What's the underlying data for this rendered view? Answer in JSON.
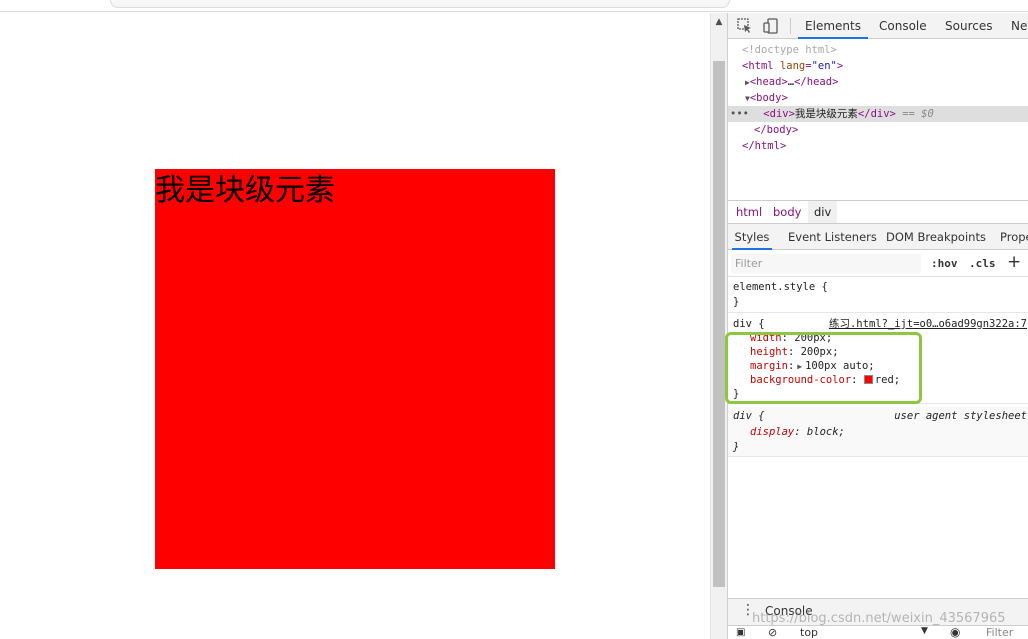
{
  "page": {
    "block_text": "我是块级元素",
    "box_color": "#ff0000"
  },
  "devtools": {
    "tabs": [
      "Elements",
      "Console",
      "Sources",
      "Net"
    ],
    "active_tab": "Elements",
    "icons": [
      "inspect-icon",
      "device-toolbar-icon"
    ],
    "tree": {
      "doctype": "<!doctype html>",
      "html_open_tag": "html",
      "html_attr": "lang",
      "html_attr_val": "\"en\"",
      "head": "head",
      "head_ellipsis": "…",
      "body": "body",
      "div": "div",
      "div_text": "我是块级元素",
      "eq": "== $0",
      "dots": "•••",
      "body_close": "body",
      "html_close": "html"
    },
    "breadcrumbs": [
      "html",
      "body",
      "div"
    ],
    "style_tabs": [
      "Styles",
      "Event Listeners",
      "DOM Breakpoints",
      "Prope"
    ],
    "filter_placeholder": "Filter",
    "hov": ":hov",
    "cls": ".cls",
    "plus": "+",
    "element_style": {
      "selector": "element.style {",
      "close": "}"
    },
    "div_rule": {
      "selector": "div {",
      "source": "练习.html?_ijt=o0…o6ad99gn322a:7",
      "props": [
        {
          "name": "width",
          "value": "200px;"
        },
        {
          "name": "height",
          "value": "200px;"
        },
        {
          "name": "margin",
          "value": "100px auto;"
        },
        {
          "name": "background-color",
          "value": "red;"
        }
      ],
      "close": "}"
    },
    "ua_rule": {
      "selector": "div {",
      "source": "user agent stylesheet",
      "prop": "display",
      "value": "block;",
      "close": "}"
    },
    "drawer_label": "Console",
    "drawer_context": "top",
    "drawer_filter": "Filter",
    "accent_color": "#1a73e8",
    "highlight_color": "#8dc63f"
  },
  "watermark": "https://blog.csdn.net/weixin_43567965"
}
